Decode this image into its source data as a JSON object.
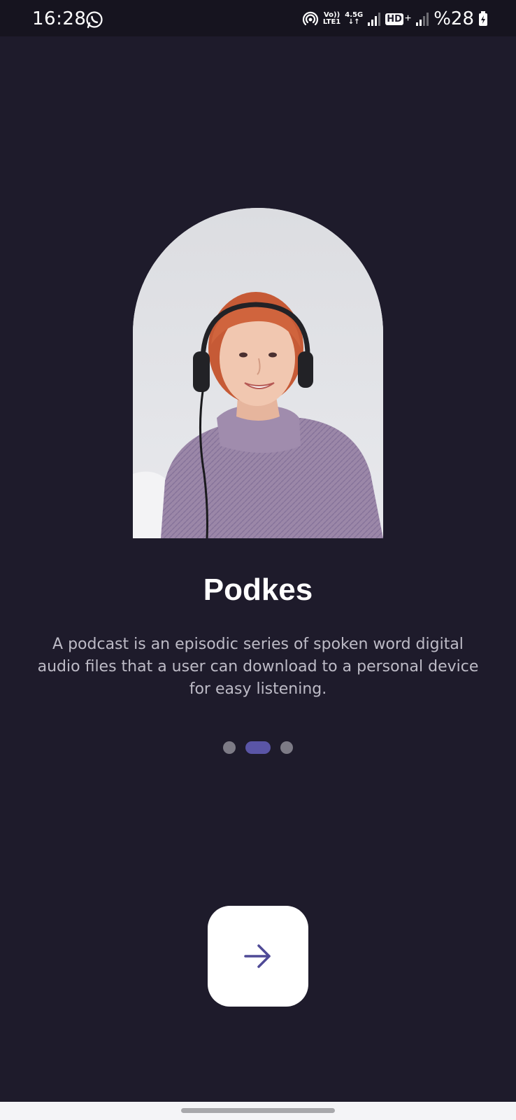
{
  "status_bar": {
    "time": "16:28",
    "network_volte": "Vo))",
    "network_lte": "LTE1",
    "network_gen": "4.5G",
    "hd_label": "HD",
    "battery_percent": "%28",
    "icons": [
      "whatsapp-icon",
      "hotspot-icon",
      "signal-icon",
      "hd-voice-icon",
      "signal-icon-2",
      "battery-icon"
    ]
  },
  "onboarding": {
    "title": "Podkes",
    "description": "A podcast is an episodic series of spoken word digital audio files that a user can download to a personal device for easy listening.",
    "page_indicator": {
      "total": 3,
      "active_index": 1
    },
    "next_button_icon": "arrow-right-icon"
  },
  "colors": {
    "background": "#1e1b2b",
    "accent": "#5a55a6",
    "button": "#ffffff",
    "text_muted": "#bdbbc6"
  }
}
